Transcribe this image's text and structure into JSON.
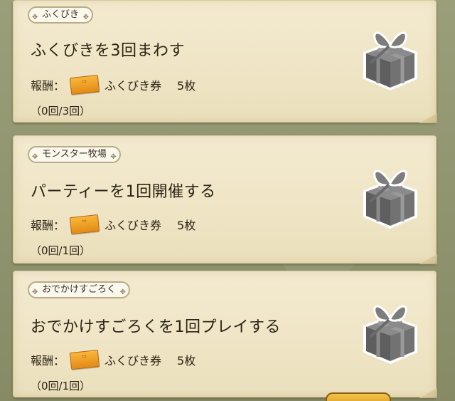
{
  "missions": [
    {
      "category": "ふくびき",
      "title": "ふくびきを3回まわす",
      "reward_label": "報酬：",
      "reward_item": "ふくびき券",
      "reward_count": "5枚",
      "progress": "（0回/3回）"
    },
    {
      "category": "モンスター牧場",
      "title": "パーティーを1回開催する",
      "reward_label": "報酬：",
      "reward_item": "ふくびき券",
      "reward_count": "5枚",
      "progress": "（0回/1回）"
    },
    {
      "category": "おでかけすごろく",
      "title": "おでかけすごろくを1回プレイする",
      "reward_label": "報酬：",
      "reward_item": "ふくびき券",
      "reward_count": "5枚",
      "progress": "（0回/1回）"
    }
  ],
  "icons": {
    "reward_ticket": "ticket-icon",
    "gift": "gift-box-icon"
  },
  "colors": {
    "card_bg": "#f3ead0",
    "gift_gray": "#6f6f6f",
    "ticket_orange": "#f0a02a"
  }
}
